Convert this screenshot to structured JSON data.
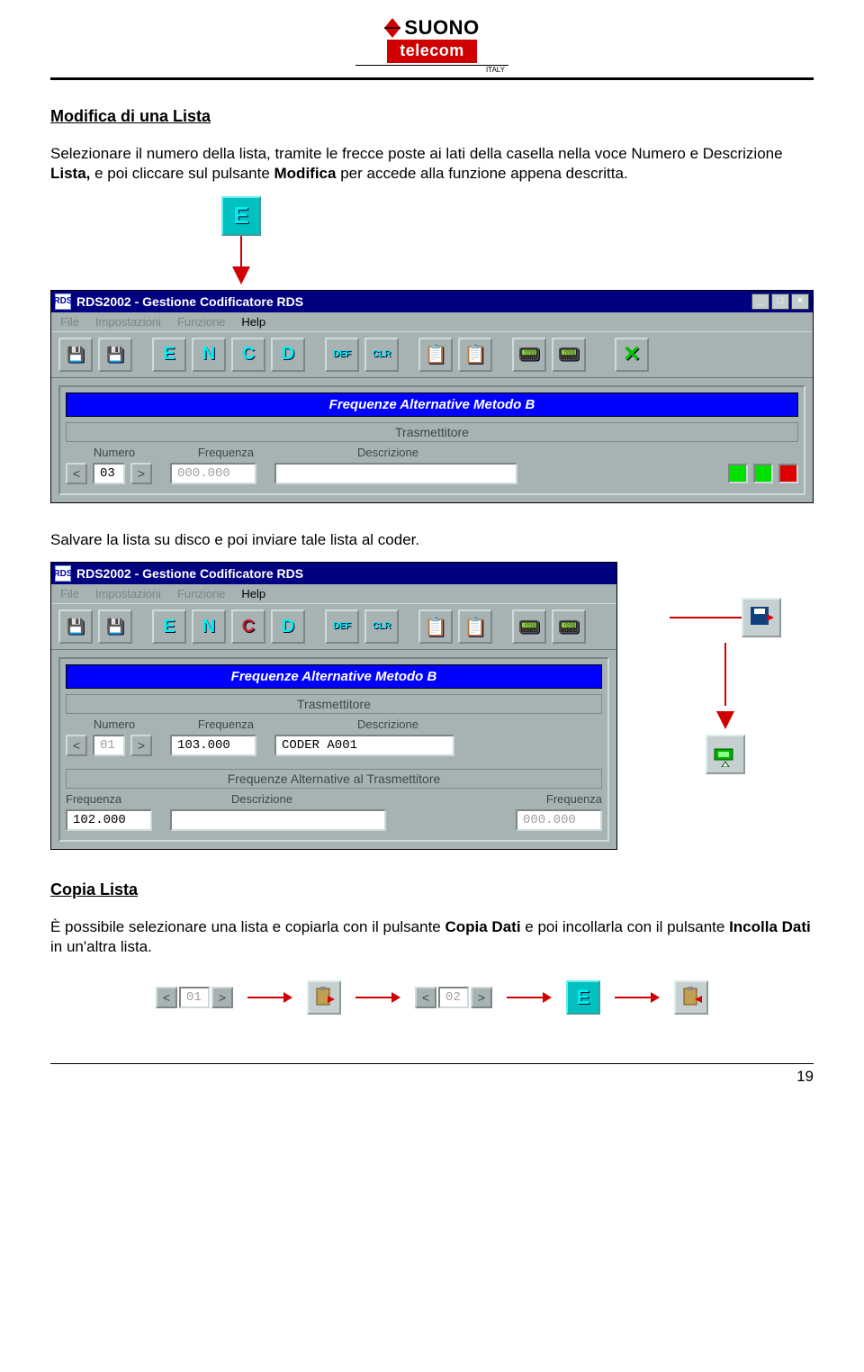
{
  "logo": {
    "line1": "SUONO",
    "line2": "telecom",
    "sub": "ITALY"
  },
  "section1": {
    "title": "Modifica di una Lista",
    "p1a": "Selezionare il numero della lista, tramite le frecce poste ai lati della casella nella voce Numero e Descrizione ",
    "p1b": "Lista,",
    "p1c": " e poi cliccare sul pulsante ",
    "p1d": "Modifica",
    "p1e": " per accede alla funzione appena descritta."
  },
  "callouts": {
    "E": "E"
  },
  "win1": {
    "title": "RDS2002 - Gestione Codificatore RDS",
    "menu": [
      "File",
      "Impostazioni",
      "Funzione",
      "Help"
    ],
    "tb": {
      "E": "E",
      "N": "N",
      "C": "C",
      "D": "D",
      "DEF": "DEF",
      "CLR": "CLR"
    },
    "panelTitle": "Frequenze Alternative Metodo B",
    "sub": "Trasmettitore",
    "labels": {
      "numero": "Numero",
      "frequenza": "Frequenza",
      "descrizione": "Descrizione"
    },
    "numero": "03",
    "freq": "000.000",
    "desc": ""
  },
  "midText": "Salvare la lista su disco e poi inviare tale lista al coder.",
  "win2": {
    "title": "RDS2002 - Gestione Codificatore RDS",
    "menu": [
      "File",
      "Impostazioni",
      "Funzione",
      "Help"
    ],
    "tb": {
      "E": "E",
      "N": "N",
      "C": "C",
      "D": "D",
      "DEF": "DEF",
      "CLR": "CLR"
    },
    "panelTitle": "Frequenze Alternative Metodo B",
    "sub": "Trasmettitore",
    "labels": {
      "numero": "Numero",
      "frequenza": "Frequenza",
      "descrizione": "Descrizione"
    },
    "numero": "01",
    "freq1": "103.000",
    "desc1": "CODER A001",
    "sub2": "Frequenze Alternative al Trasmettitore",
    "labels2": {
      "frequenza": "Frequenza",
      "descrizione": "Descrizione",
      "frequenza2": "Frequenza"
    },
    "freqA": "102.000",
    "descA": "",
    "freqB": "000.000"
  },
  "section3": {
    "title": "Copia Lista",
    "p2a": "È possibile selezionare una lista e copiarla con il pulsante ",
    "p2b": "Copia Dati",
    "p2c": " e poi incollarla con il pulsante ",
    "p2d": "Incolla Dati",
    "p2e": " in un'altra lista."
  },
  "bottomRow": {
    "n1": "01",
    "n2": "02",
    "E": "E"
  },
  "pageNum": "19"
}
